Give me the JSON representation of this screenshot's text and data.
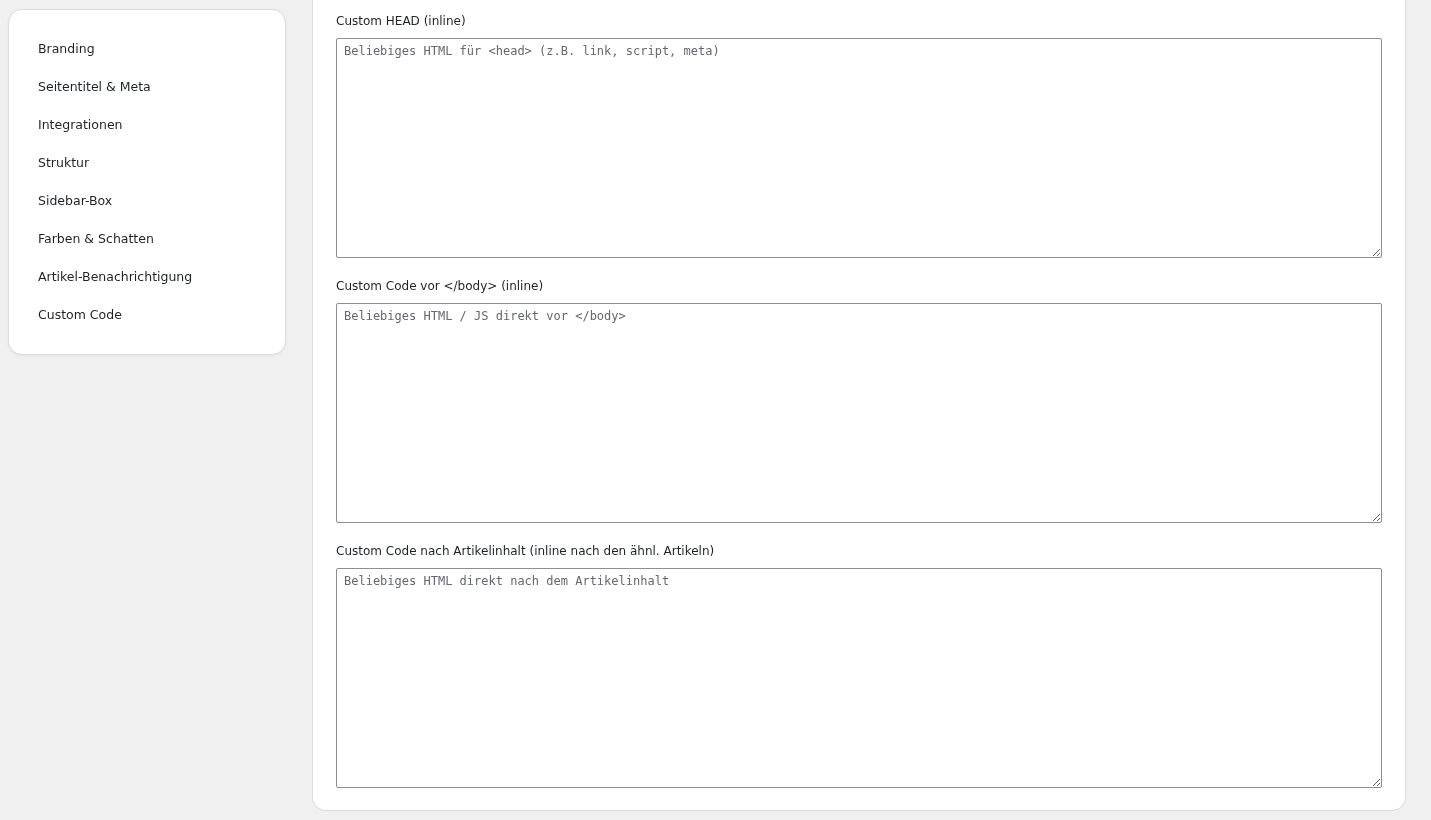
{
  "sidebar": {
    "items": [
      {
        "label": "Branding"
      },
      {
        "label": "Seitentitel & Meta"
      },
      {
        "label": "Integrationen"
      },
      {
        "label": "Struktur"
      },
      {
        "label": "Sidebar-Box"
      },
      {
        "label": "Farben & Schatten"
      },
      {
        "label": "Artikel-Benachrichtigung"
      },
      {
        "label": "Custom Code"
      }
    ]
  },
  "fields": [
    {
      "label": "Custom HEAD (inline)",
      "placeholder": "Beliebiges HTML für <head> (z.B. link, script, meta)"
    },
    {
      "label": "Custom Code vor </body> (inline)",
      "placeholder": "Beliebiges HTML / JS direkt vor </body>"
    },
    {
      "label": "Custom Code nach Artikelinhalt (inline nach den ähnl. Artikeln)",
      "placeholder": "Beliebiges HTML direkt nach dem Artikelinhalt"
    }
  ]
}
